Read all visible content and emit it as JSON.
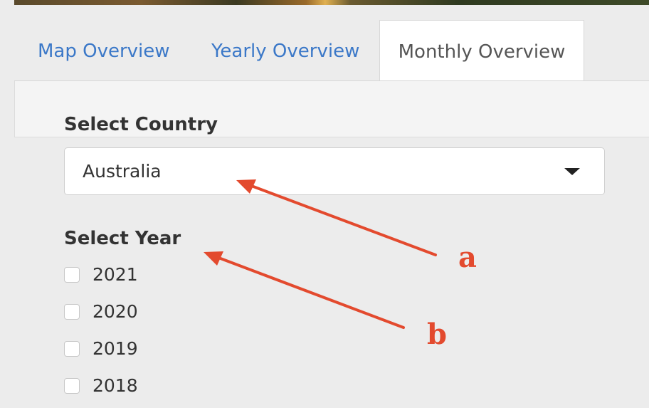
{
  "tabs": [
    {
      "label": "Map Overview",
      "active": false
    },
    {
      "label": "Yearly Overview",
      "active": false
    },
    {
      "label": "Monthly Overview",
      "active": true
    }
  ],
  "country_select": {
    "label": "Select Country",
    "value": "Australia"
  },
  "year_select": {
    "label": "Select Year",
    "options": [
      {
        "label": "2021",
        "checked": false
      },
      {
        "label": "2020",
        "checked": false
      },
      {
        "label": "2019",
        "checked": false
      },
      {
        "label": "2018",
        "checked": false
      }
    ]
  },
  "annotations": {
    "a": "a",
    "b": "b",
    "color": "#e34a2e"
  },
  "colors": {
    "tab_link": "#3b78c8",
    "background": "#ececec"
  }
}
